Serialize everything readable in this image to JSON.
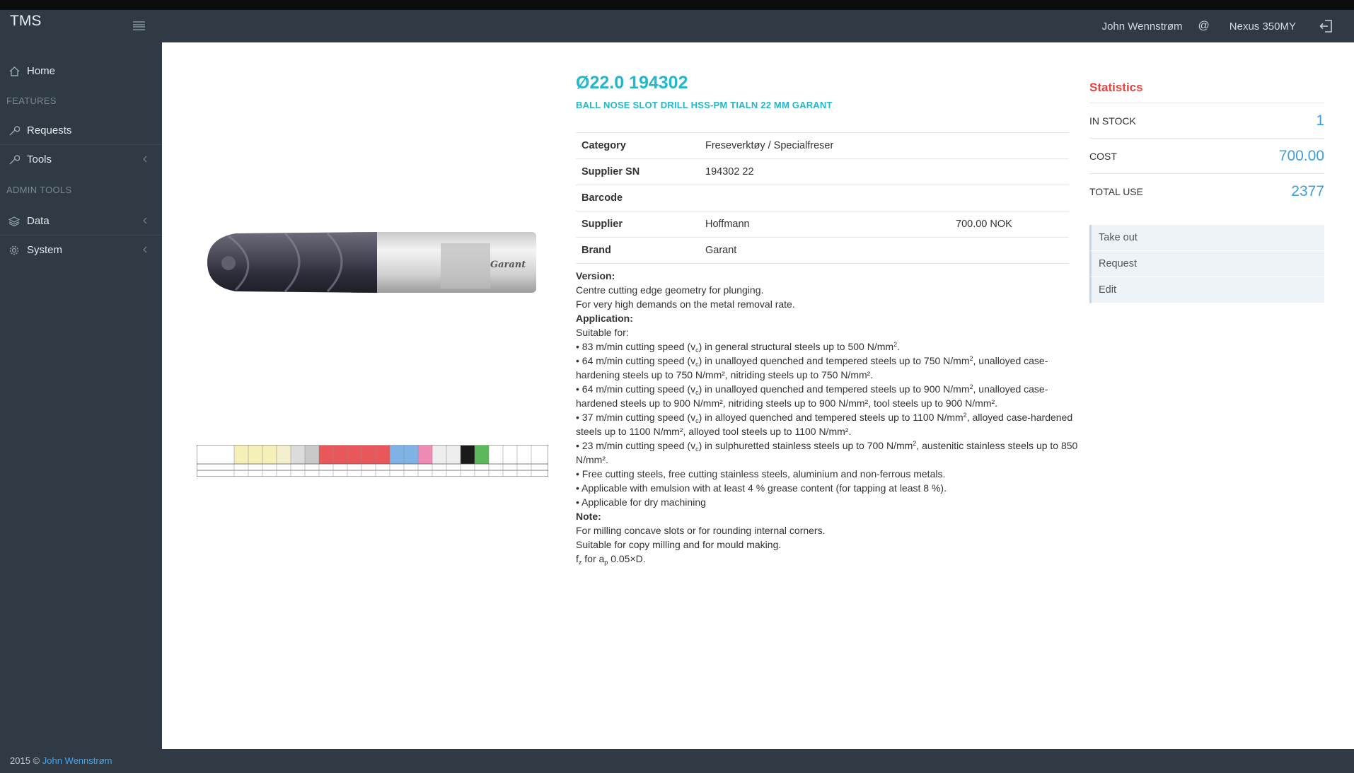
{
  "app": {
    "brand": "TMS",
    "user_name": "John Wennstrøm",
    "at_symbol": "@",
    "machine": "Nexus 350MY"
  },
  "sidebar": {
    "home": "Home",
    "features_header": "FEATURES",
    "requests": "Requests",
    "tools": "Tools",
    "admin_header": "ADMIN TOOLS",
    "data": "Data",
    "system": "System"
  },
  "product": {
    "title": "Ø22.0 194302",
    "subtitle": "BALL NOSE SLOT DRILL HSS-PM TIALN 22 MM GARANT",
    "image_logo": "Garant",
    "details": [
      {
        "label": "Category",
        "value": "Freseverktøy / Specialfreser",
        "extra": ""
      },
      {
        "label": "Supplier SN",
        "value": "194302 22",
        "extra": ""
      },
      {
        "label": "Barcode",
        "value": "",
        "extra": ""
      },
      {
        "label": "Supplier",
        "value": "Hoffmann",
        "extra": "700.00 NOK"
      },
      {
        "label": "Brand",
        "value": "Garant",
        "extra": ""
      }
    ]
  },
  "description": {
    "version_heading": "Version:",
    "version_lines": [
      "Centre cutting edge geometry for plunging.",
      "For very high demands on the metal removal rate."
    ],
    "application_heading": "Application:",
    "suitable_for": "Suitable for:",
    "bullets": [
      {
        "pre": "• 83 m/min cutting speed (v",
        "sub": "c",
        "post": ") in general structural steels up to 500 N/mm",
        "sup": "2",
        "tail": "."
      },
      {
        "pre": "• 64 m/min cutting speed (v",
        "sub": "c",
        "post": ") in unalloyed quenched and tempered steels up to 750 N/mm",
        "sup": "2",
        "tail": ", unalloyed case-hardening steels up to 750 N/mm², nitriding steels up to 750 N/mm²."
      },
      {
        "pre": "• 64 m/min cutting speed (v",
        "sub": "c",
        "post": ") in unalloyed quenched and tempered steels up to 900 N/mm",
        "sup": "2",
        "tail": ", unalloyed case-hardened steels up to 900 N/mm², nitriding steels up to 900 N/mm², tool steels up to 900 N/mm²."
      },
      {
        "pre": "• 37 m/min cutting speed (v",
        "sub": "c",
        "post": ") in alloyed quenched and tempered steels up to 1100 N/mm",
        "sup": "2",
        "tail": ", alloyed case-hardened steels up to 1100 N/mm², alloyed tool steels up to 1100 N/mm²."
      },
      {
        "pre": "• 23 m/min cutting speed (v",
        "sub": "c",
        "post": ") in sulphuretted stainless steels up to 700 N/mm",
        "sup": "2",
        "tail": ", austenitic stainless steels up to 850 N/mm²."
      }
    ],
    "plain_bullets": [
      "• Free cutting steels, free cutting stainless steels, aluminium and non-ferrous metals.",
      "• Applicable with emulsion with at least 4 % grease content (for tapping at least 8 %).",
      "• Applicable for dry machining"
    ],
    "note_heading": "Note:",
    "note_lines": [
      "For milling concave slots or for rounding internal corners.",
      "Suitable for copy milling and for mould making."
    ],
    "fz_pre": "f",
    "fz_sub": "z",
    "fz_mid": " for a",
    "fz_sub2": "p",
    "fz_post": " 0.05×D."
  },
  "statistics": {
    "title": "Statistics",
    "rows": [
      {
        "label": "IN STOCK",
        "value": "1"
      },
      {
        "label": "COST",
        "value": "700.00"
      },
      {
        "label": "TOTAL USE",
        "value": "2377"
      }
    ],
    "actions": [
      "Take out",
      "Request",
      "Edit"
    ]
  },
  "footer": {
    "copyright": "2015 © ",
    "author": "John Wennstrøm"
  },
  "colors": {
    "sidebar_bg": "#2f3a44",
    "accent_teal": "#23b7c9",
    "stat_title_red": "#e2443f",
    "stat_value_blue": "#3b9fd9"
  }
}
